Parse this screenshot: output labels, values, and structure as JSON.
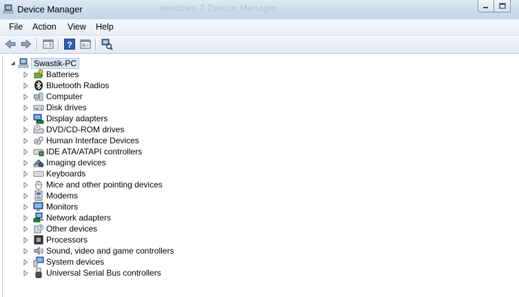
{
  "window": {
    "title": "Device Manager",
    "ghost_title": "windows 7 Device Manager"
  },
  "menu": [
    "File",
    "Action",
    "View",
    "Help"
  ],
  "toolbar": {
    "buttons": [
      "back-icon",
      "forward-icon",
      "show-hide-console-tree-icon",
      "help-icon",
      "properties-icon",
      "scan-hardware-icon"
    ]
  },
  "tree": {
    "root": "Swastik-PC",
    "items": [
      {
        "label": "Batteries",
        "icon": "battery-icon"
      },
      {
        "label": "Bluetooth Radios",
        "icon": "bluetooth-icon"
      },
      {
        "label": "Computer",
        "icon": "computer-icon"
      },
      {
        "label": "Disk drives",
        "icon": "disk-drive-icon"
      },
      {
        "label": "Display adapters",
        "icon": "display-adapter-icon"
      },
      {
        "label": "DVD/CD-ROM drives",
        "icon": "dvd-drive-icon"
      },
      {
        "label": "Human Interface Devices",
        "icon": "hid-icon"
      },
      {
        "label": "IDE ATA/ATAPI controllers",
        "icon": "ide-controller-icon"
      },
      {
        "label": "Imaging devices",
        "icon": "imaging-device-icon"
      },
      {
        "label": "Keyboards",
        "icon": "keyboard-icon"
      },
      {
        "label": "Mice and other pointing devices",
        "icon": "mouse-icon"
      },
      {
        "label": "Modems",
        "icon": "modem-icon"
      },
      {
        "label": "Monitors",
        "icon": "monitor-icon"
      },
      {
        "label": "Network adapters",
        "icon": "network-adapter-icon"
      },
      {
        "label": "Other devices",
        "icon": "other-devices-icon"
      },
      {
        "label": "Processors",
        "icon": "processor-icon"
      },
      {
        "label": "Sound, video and game controllers",
        "icon": "sound-icon"
      },
      {
        "label": "System devices",
        "icon": "system-devices-icon"
      },
      {
        "label": "Universal Serial Bus controllers",
        "icon": "usb-icon"
      }
    ]
  }
}
